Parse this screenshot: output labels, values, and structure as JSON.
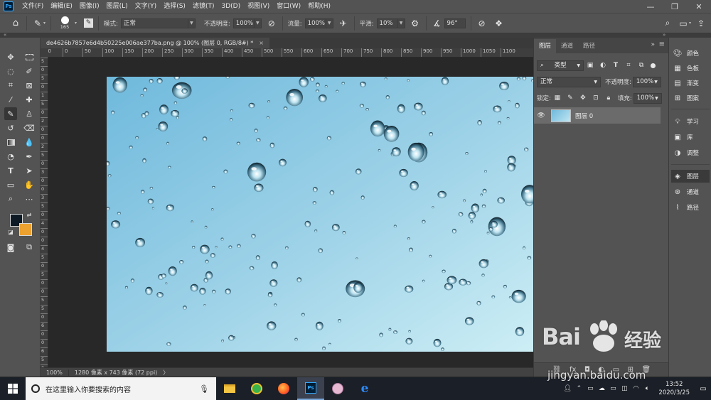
{
  "menubar": {
    "items": [
      "文件(F)",
      "编辑(E)",
      "图像(I)",
      "图层(L)",
      "文字(Y)",
      "选择(S)",
      "滤镜(T)",
      "3D(D)",
      "视图(V)",
      "窗口(W)",
      "帮助(H)"
    ]
  },
  "options": {
    "brush_size": "165",
    "mode_label": "模式:",
    "mode_value": "正常",
    "opacity_label": "不透明度:",
    "opacity_value": "100%",
    "flow_label": "流量:",
    "flow_value": "100%",
    "smoothing_label": "平滑:",
    "smoothing_value": "10%",
    "angle_value": "96°"
  },
  "document": {
    "tab_title": "de4626b7857e6d4b50225e006ae377ba.png @ 100% (图层 0, RGB/8#) *",
    "ruler_h": [
      "50",
      "0",
      "50",
      "100",
      "150",
      "200",
      "250",
      "300",
      "350",
      "400",
      "450",
      "500",
      "550",
      "600",
      "650",
      "700",
      "750",
      "800",
      "850",
      "900",
      "950",
      "1000",
      "1050",
      "1100"
    ],
    "ruler_v": [
      "5",
      "0",
      "5",
      "0",
      "1",
      "5",
      "0",
      "2",
      "0",
      "0",
      "2",
      "5",
      "0",
      "3",
      "0",
      "0",
      "3",
      "5",
      "0",
      "4",
      "0",
      "0",
      "4",
      "5",
      "0",
      "5",
      "0",
      "0",
      "5",
      "5",
      "0",
      "6",
      "0",
      "0",
      "6",
      "5",
      "0"
    ],
    "status_zoom": "100%",
    "status_info": "1280 像素 x 743 像素 (72 ppi)",
    "status_arrow": "〉"
  },
  "layers_panel": {
    "tabs": [
      "图层",
      "通道",
      "路径"
    ],
    "filter_label": "类型",
    "blend_mode": "正常",
    "opacity_label": "不透明度:",
    "opacity_value": "100%",
    "lock_label": "锁定:",
    "fill_label": "填充:",
    "fill_value": "100%",
    "layer_name": "图层 0"
  },
  "dock": {
    "items": [
      "颜色",
      "色板",
      "渐变",
      "图案",
      "学习",
      "库",
      "调整",
      "图层",
      "通道",
      "路径"
    ]
  },
  "taskbar": {
    "search_placeholder": "在这里输入你要搜索的内容",
    "time": "13:52",
    "date": "2020/3/25"
  },
  "watermark": {
    "brand": "Bai",
    "brand_cn": "经验",
    "url": "jingyan.baidu.com"
  },
  "colors": {
    "foreground": "#0d1a25",
    "background": "#eda12e",
    "photo_sky_top": "#6fb9dc",
    "photo_sky_bottom": "#cdeef5"
  }
}
